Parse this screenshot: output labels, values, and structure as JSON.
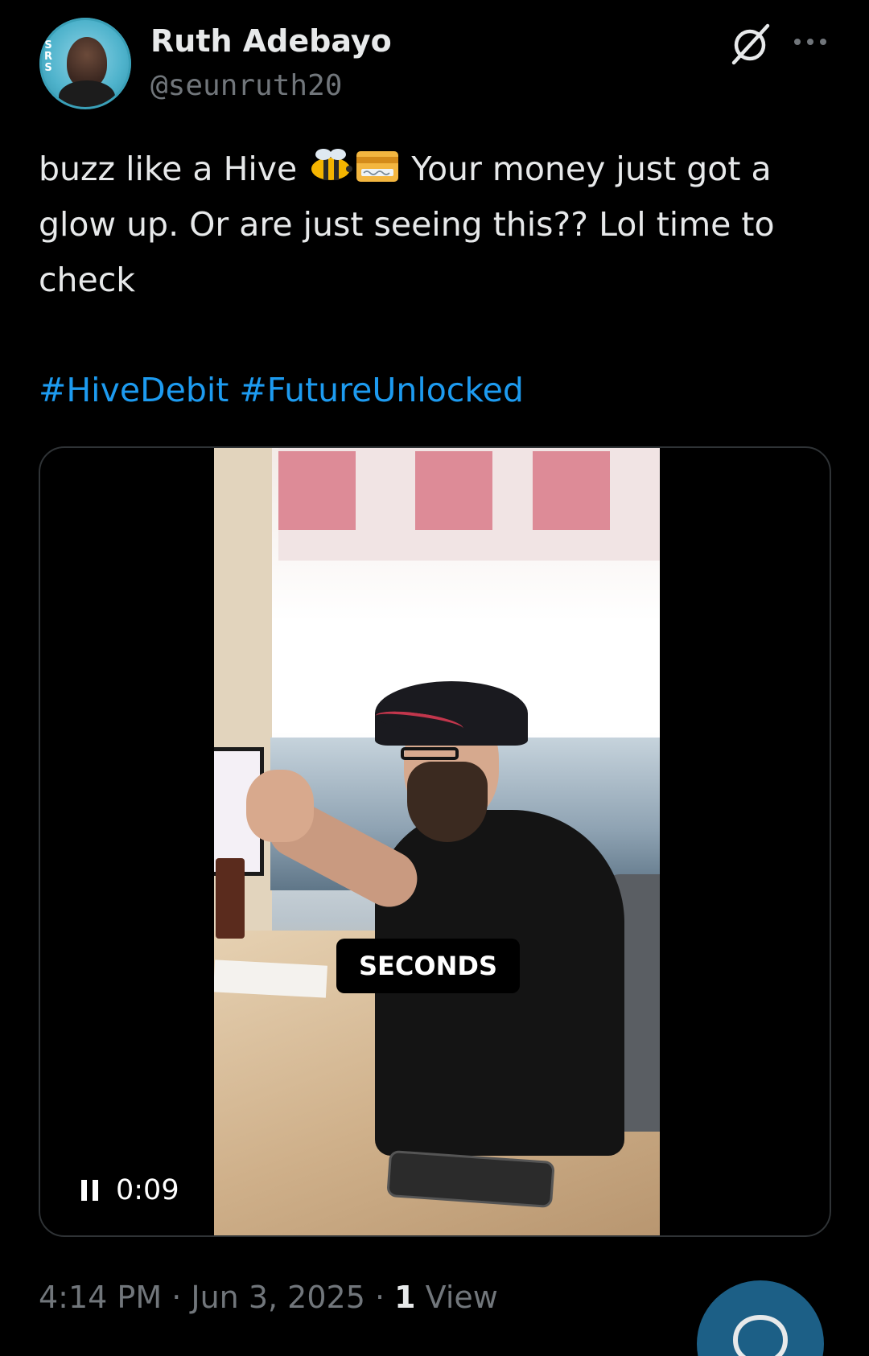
{
  "author": {
    "display_name": "Ruth Adebayo",
    "handle": "@seunruth20",
    "avatar_icon": "profile-photo",
    "avatar_badge_letters": [
      "S",
      "R",
      "S"
    ]
  },
  "actions": {
    "grok_icon": "grok-slash-icon",
    "more_icon": "more-horizontal-icon"
  },
  "tweet": {
    "text_part1": "buzz like a Hive ",
    "emoji1": "honeybee",
    "emoji2": "credit-card",
    "text_part2": " Your money just got a glow up. Or are just seeing this?? Lol time to check",
    "hashtags": [
      "#HiveDebit",
      "#FutureUnlocked"
    ]
  },
  "media": {
    "caption": "SECONDS",
    "elapsed": "0:09",
    "control_icon": "pause-icon"
  },
  "meta": {
    "time": "4:14 PM",
    "separator": " · ",
    "date": "Jun 3, 2025",
    "views_count": "1",
    "views_label": " View"
  },
  "compose": {
    "icon": "compose-icon"
  },
  "colors": {
    "background": "#000000",
    "primary_text": "#e7e9ea",
    "secondary_text": "#71767b",
    "link": "#1d9bf0",
    "border": "#2f3336"
  }
}
